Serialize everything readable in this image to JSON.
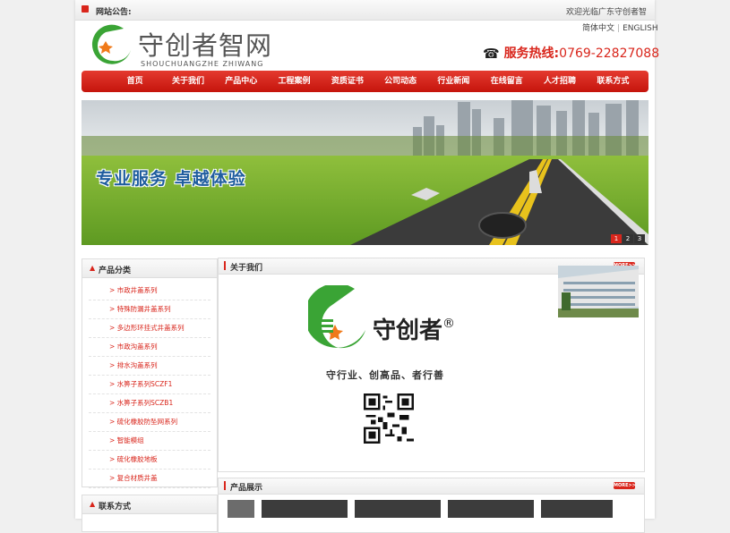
{
  "notice": {
    "label": "网站公告:",
    "text": "欢迎光临广东守创者智"
  },
  "header": {
    "logo_cn": "守创者智网",
    "logo_en": "SHOUCHUANGZHE ZHIWANG",
    "lang_cn": "简体中文",
    "lang_sep": "|",
    "lang_en": "ENGLISH",
    "hotline_label": "服务热线:",
    "hotline_number": "0769-22827088"
  },
  "nav": {
    "items": [
      "首页",
      "关于我们",
      "产品中心",
      "工程案例",
      "资质证书",
      "公司动态",
      "行业新闻",
      "在线留言",
      "人才招聘",
      "联系方式"
    ]
  },
  "banner": {
    "slogan": "专业服务  卓越体验",
    "dots": [
      "1",
      "2",
      "3"
    ]
  },
  "sidebar": {
    "categories_title": "产品分类",
    "categories": [
      "> 市政井盖系列",
      "> 特殊防漏井盖系列",
      "> 多边形环挂式井盖系列",
      "> 市政沟盖系列",
      "> 排水沟盖系列",
      "> 水箅子系列SCZF1",
      "> 水箅子系列SCZB1",
      "> 硫化橡胶防坠网系列",
      "> 智能模组",
      "> 硫化橡胶地板",
      "> 复合材质井盖"
    ],
    "contact_title": "联系方式"
  },
  "about": {
    "title": "关于我们",
    "more": "MORE>>",
    "logo_text": "守创者",
    "registered": "®",
    "motto": "守行业、创高品、者行善"
  },
  "products": {
    "title": "产品展示",
    "more": "MORE>>"
  },
  "colors": {
    "accent": "#d9261c",
    "nav": "#cf1d14",
    "logo_green": "#3aa435",
    "slogan": "#1f5d9e"
  }
}
